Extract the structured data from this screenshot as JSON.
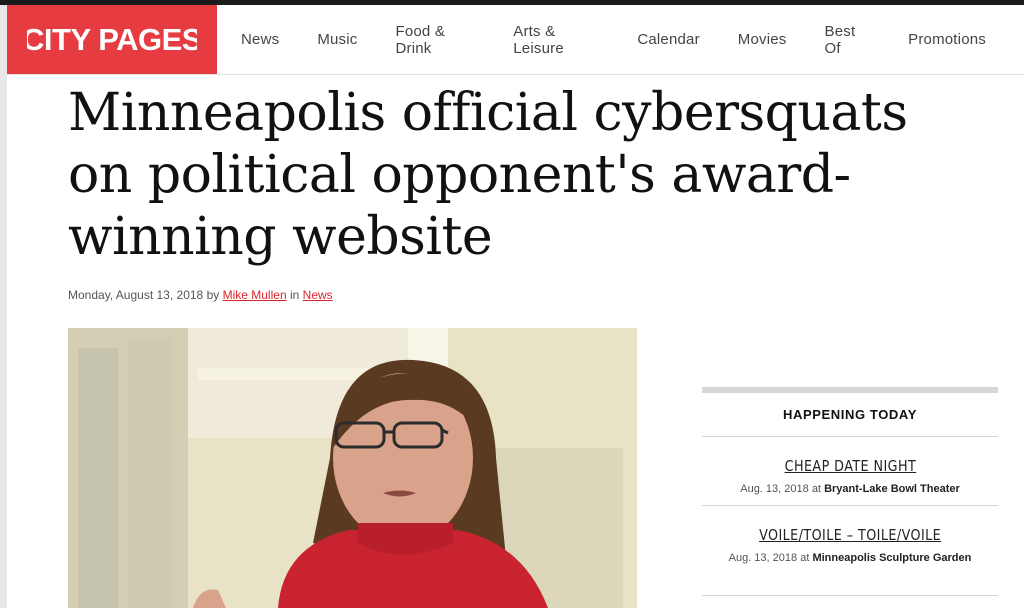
{
  "header": {
    "logo_text": "CITY PAGES",
    "nav": [
      "News",
      "Music",
      "Food & Drink",
      "Arts & Leisure",
      "Calendar",
      "Movies",
      "Best Of",
      "Promotions"
    ]
  },
  "article": {
    "headline": "Minneapolis official cybersquats on political opponent's award-winning website",
    "date": "Monday, August 13, 2018",
    "by_word": "by",
    "author": "Mike Mullen",
    "in_word": "in",
    "section": "News"
  },
  "sidebar": {
    "title": "HAPPENING TODAY",
    "events": [
      {
        "name": "CHEAP DATE NIGHT",
        "date": "Aug. 13, 2018",
        "at": "at",
        "venue": "Bryant-Lake Bowl Theater"
      },
      {
        "name": "VOILE/TOILE – TOILE/VOILE",
        "date": "Aug. 13, 2018",
        "at": "at",
        "venue": "Minneapolis Sculpture Garden"
      }
    ]
  },
  "colors": {
    "brand_red": "#e63b41",
    "link_red": "#d8262d"
  }
}
